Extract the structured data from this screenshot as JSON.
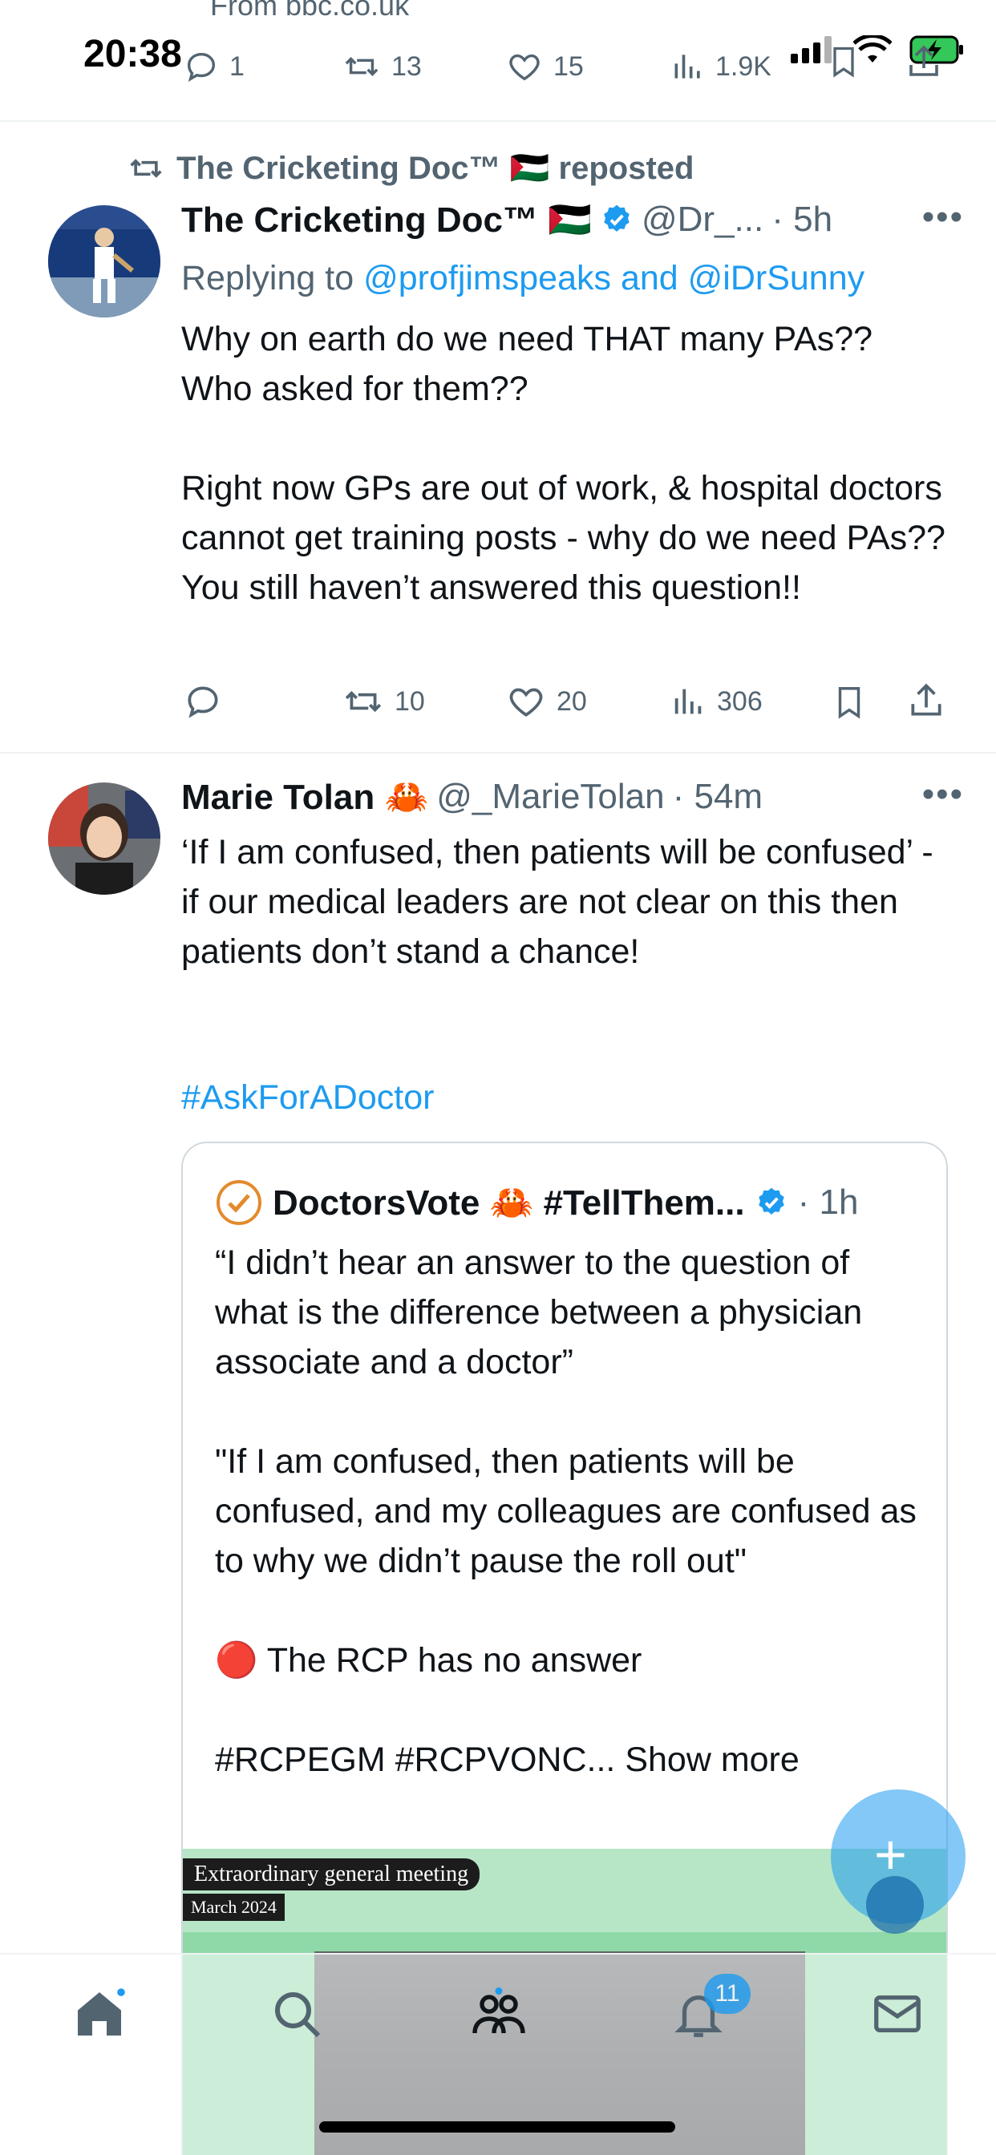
{
  "status_bar": {
    "from_text": "From bbc.co.uk",
    "time": "20:38"
  },
  "prev_tweet_actions": {
    "replies": "1",
    "reposts": "13",
    "likes": "15",
    "views": "1.9K"
  },
  "tweet1": {
    "repost_by": "The Cricketing Doc™ 🇵🇸 reposted",
    "author_name": "The Cricketing Doc™ 🇵🇸",
    "handle": "@Dr_...",
    "time": "· 5h",
    "replying_prefix": "Replying to ",
    "replying_to": "@profjimspeaks and @iDrSunny",
    "text": "Why on earth do we need THAT many PAs??\nWho asked for them??\n\nRight now GPs are out of work, & hospital doctors cannot get training posts - why do we need PAs?? You still haven’t answered this question!!",
    "replies": "",
    "reposts": "10",
    "likes": "20",
    "views": "306"
  },
  "tweet2": {
    "author_name": "Marie Tolan 🦀",
    "handle": "@_MarieTolan",
    "time": "· 54m",
    "text": "‘If I am confused, then patients will be confused’ - if our medical leaders are not clear on this then patients don’t stand a chance!",
    "hashtag": "#AskForADoctor",
    "quote": {
      "author_name": "DoctorsVote 🦀 #TellThem...",
      "time": "· 1h",
      "text": "“I didn’t hear an answer to the question of what is the difference between a physician associate and a doctor”\n\n\"If I am confused, then patients will be confused, and my colleagues are confused as to why we didn’t pause the roll out\"\n\n🔴 The RCP has no answer\n\n#RCPEGM #RCPVONC... Show more",
      "media_label_1": "Extraordinary general meeting",
      "media_label_2": "March 2024"
    }
  },
  "nav": {
    "notifications_badge": "11"
  },
  "colors": {
    "accent": "#1d9bf0",
    "secondary_text": "#536471",
    "primary_text": "#0f1419"
  }
}
